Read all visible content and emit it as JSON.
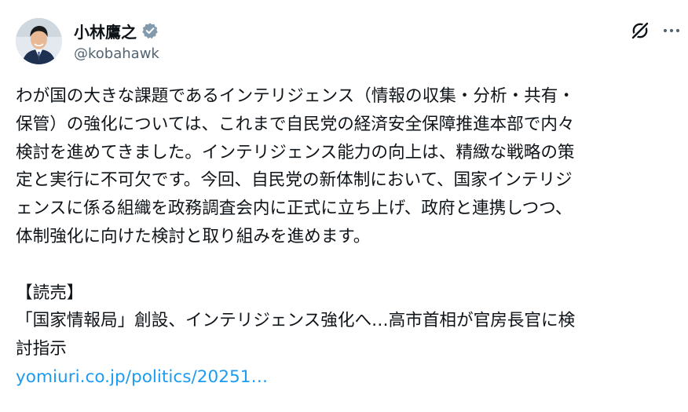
{
  "author": {
    "display_name": "小林鷹之",
    "handle": "@kobahawk",
    "verified": true,
    "avatar_icon": "avatar-photo-icon"
  },
  "header_icons": {
    "grok": "grok-icon",
    "more": "more-icon"
  },
  "post": {
    "lines": [
      "わが国の大きな課題であるインテリジェンス（情報の収集・分析・共有・",
      "保管）の強化については、これまで自民党の経済安全保障推進本部で内々",
      "検討を進めてきました。インテリジェンス能力の向上は、精緻な戦略の策",
      "定と実行に不可欠です。今回、自民党の新体制において、国家インテリジ",
      "ェンスに係る組織を政務調査会内に正式に立ち上げ、政府と連携しつつ、",
      "体制強化に向けた検討と取り組みを進めます。"
    ],
    "source_label": "【読売】",
    "quote_lines": [
      "「国家情報局」創設、インテリジェンス強化へ…高市首相が官房長官に検",
      "討指示"
    ],
    "link_text": "yomiuri.co.jp/politics/20251…"
  },
  "colors": {
    "text": "#0f1419",
    "secondary": "#536471",
    "link": "#1d9bf0",
    "verified_badge": "#829aab"
  }
}
